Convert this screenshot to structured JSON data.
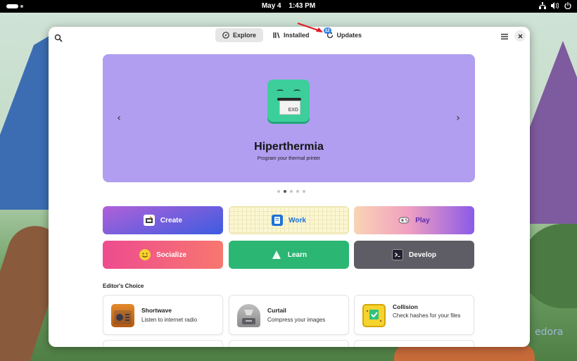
{
  "topbar": {
    "date": "May 4",
    "time": "1:43 PM"
  },
  "wallpaper": {
    "logo_text": "edora"
  },
  "header": {
    "tabs": [
      {
        "label": "Explore",
        "icon": "compass-icon",
        "active": true
      },
      {
        "label": "Installed",
        "icon": "library-icon",
        "active": false
      },
      {
        "label": "Updates",
        "icon": "refresh-icon",
        "active": false,
        "badge": "12"
      }
    ]
  },
  "carousel": {
    "title": "Hiperthermia",
    "subtitle": "Program your thermal printer",
    "icon_label": "EXD",
    "page_count": 5,
    "current_page": 2
  },
  "categories": [
    {
      "label": "Create",
      "icon": "create-icon"
    },
    {
      "label": "Work",
      "icon": "work-icon"
    },
    {
      "label": "Play",
      "icon": "gamepad-icon"
    },
    {
      "label": "Socialize",
      "icon": "smiley-icon"
    },
    {
      "label": "Learn",
      "icon": "learn-icon"
    },
    {
      "label": "Develop",
      "icon": "terminal-icon"
    }
  ],
  "editors_choice": {
    "title": "Editor's Choice",
    "apps": [
      {
        "name": "Shortwave",
        "description": "Listen to internet radio",
        "icon": "radio-icon"
      },
      {
        "name": "Curtail",
        "description": "Compress your images",
        "icon": "curtail-icon"
      },
      {
        "name": "Collision",
        "description": "Check hashes for your files",
        "icon": "collision-icon"
      }
    ]
  },
  "colors": {
    "carousel_bg": "#b19ef0",
    "accent": "#3584e4",
    "annotation_arrow": "#e01b24"
  }
}
